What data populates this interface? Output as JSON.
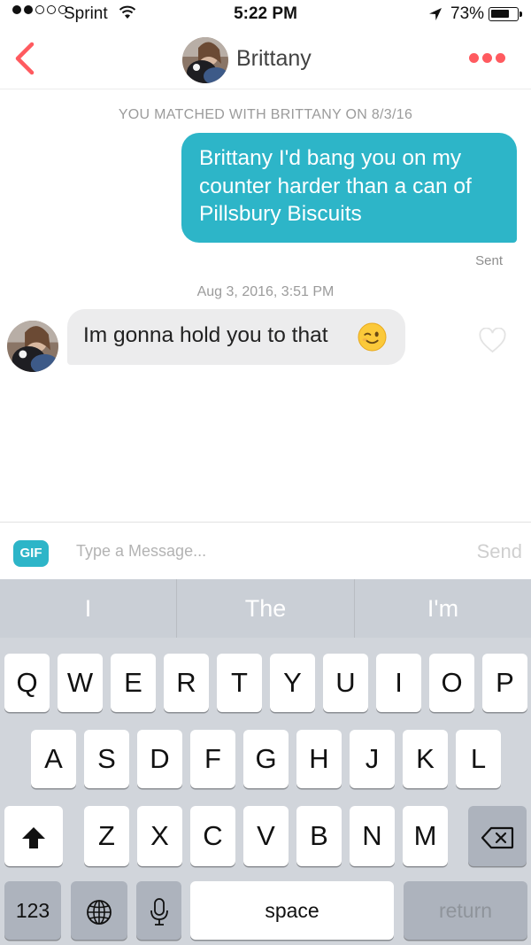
{
  "status_bar": {
    "carrier": "Sprint",
    "time": "5:22 PM",
    "battery_percent": "73%",
    "battery_level": 0.73,
    "signal_bars_filled": 2,
    "signal_bars_total": 5
  },
  "header": {
    "contact_name": "Brittany",
    "back_icon": "chevron-left-icon",
    "menu_icon": "more-dots-icon",
    "accent_color": "#ff5a5f"
  },
  "conversation": {
    "match_note": "YOU MATCHED WITH BRITTANY ON 8/3/16",
    "outgoing_message": "Brittany I'd bang you on my counter harder than a can of Pillsbury Biscuits",
    "outgoing_status": "Sent",
    "timestamp": "Aug 3, 2016, 3:51 PM",
    "incoming_message": "Im gonna hold you to that",
    "incoming_emoji": "winking-face-emoji",
    "bubble_color": "#2db5c8"
  },
  "composer": {
    "gif_label": "GIF",
    "placeholder": "Type a Message...",
    "value": "",
    "send_label": "Send"
  },
  "keyboard": {
    "suggestions": [
      "I",
      "The",
      "I'm"
    ],
    "row1": [
      "Q",
      "W",
      "E",
      "R",
      "T",
      "Y",
      "U",
      "I",
      "O",
      "P"
    ],
    "row2": [
      "A",
      "S",
      "D",
      "F",
      "G",
      "H",
      "J",
      "K",
      "L"
    ],
    "row3": [
      "Z",
      "X",
      "C",
      "V",
      "B",
      "N",
      "M"
    ],
    "numbers_label": "123",
    "space_label": "space",
    "return_label": "return"
  }
}
